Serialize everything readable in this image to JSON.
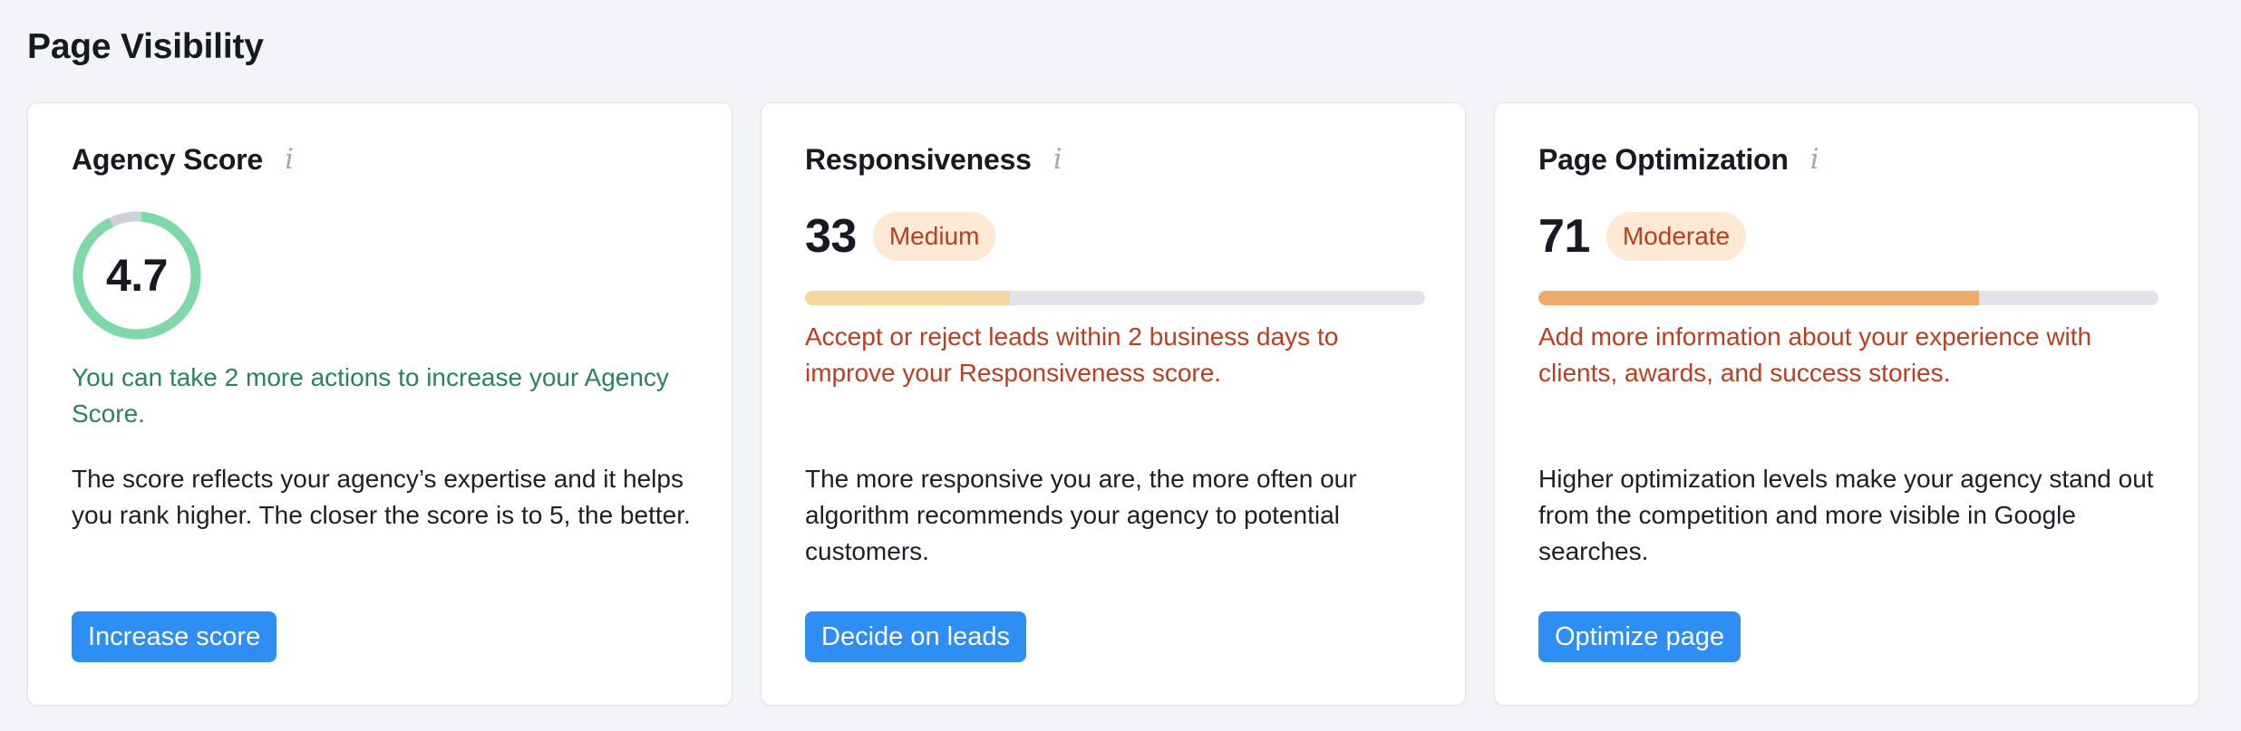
{
  "page": {
    "title": "Page Visibility"
  },
  "colors": {
    "background": "#f3f4f8",
    "card": "#ffffff",
    "primary_button": "#2e8ef3",
    "gauge_fill": "#7fd8a8",
    "gauge_track": "#cfd1d8",
    "success_text": "#2b8260",
    "warning_text": "#bf3d1d",
    "badge_bg": "#fde9d4",
    "responsiveness_bar": "#f6d7a0",
    "optimization_bar": "#eeac6c",
    "bar_track": "#e3e4ea"
  },
  "agency": {
    "title": "Agency Score",
    "info_icon": "info-icon",
    "score": "4.7",
    "score_value": 4.7,
    "score_max": 5,
    "hint": "You can take 2 more actions to increase your Agency Score.",
    "description": "The score reflects your agency’s expertise and it helps you rank higher. The closer the score is to 5, the better.",
    "button": "Increase score"
  },
  "responsiveness": {
    "title": "Responsiveness",
    "info_icon": "info-icon",
    "score": "33",
    "progress": 0.33,
    "badge": "Medium",
    "hint": "Accept or reject leads within 2 business days to improve your Responsiveness score.",
    "description": "The more responsive you are, the more often our algorithm recommends your agency to potential customers.",
    "button": "Decide on leads"
  },
  "optimization": {
    "title": "Page Optimization",
    "info_icon": "info-icon",
    "score": "71",
    "progress": 0.71,
    "badge": "Moderate",
    "hint": "Add more information about your experience with clients, awards, and success stories.",
    "description": "Higher optimization levels make your agency stand out from the competition and more visible in Google searches.",
    "button": "Optimize page"
  }
}
